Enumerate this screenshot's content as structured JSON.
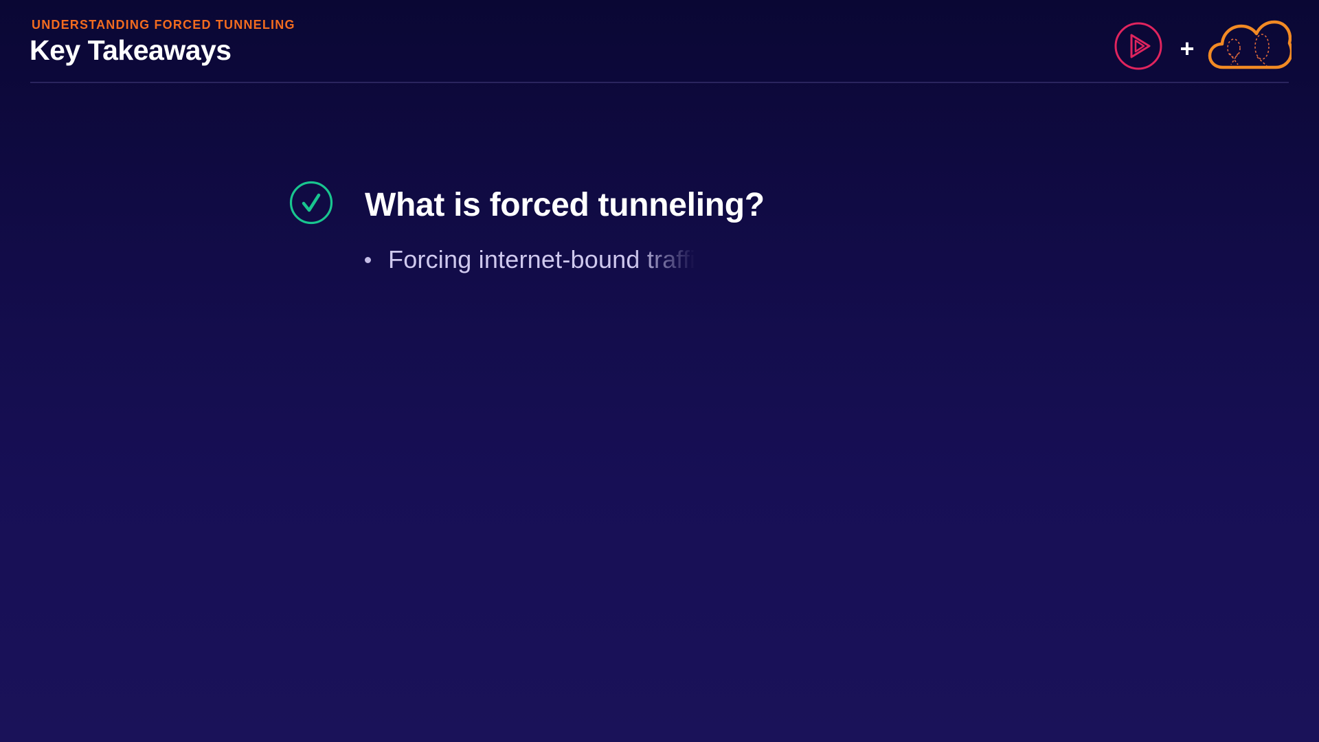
{
  "header": {
    "eyebrow": "UNDERSTANDING FORCED TUNNELING",
    "title": "Key Takeaways",
    "logos": {
      "left_icon": "play-icon",
      "separator": "+",
      "right_icon": "cloud-icon"
    }
  },
  "takeaway": {
    "icon": "check-circle-icon",
    "heading": "What is forced tunneling?",
    "bullets": [
      "Forcing internet-bound traffi"
    ]
  },
  "colors": {
    "accent_orange": "#f26b1f",
    "play_pink": "#e0245e",
    "check_green": "#19c58f",
    "background_top": "#0a0734",
    "background_bottom": "#1a1259"
  }
}
